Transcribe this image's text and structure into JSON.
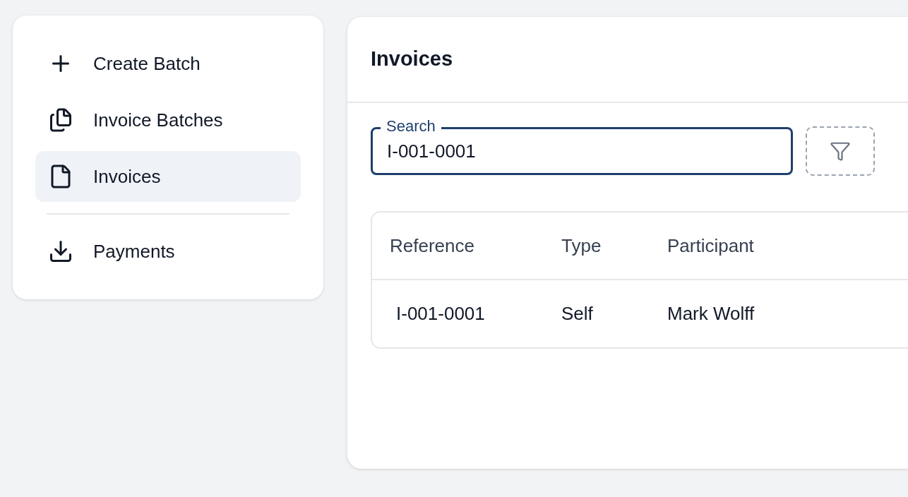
{
  "sidebar": {
    "items": [
      {
        "label": "Create Batch",
        "kind": "create",
        "selected": false
      },
      {
        "label": "Invoice Batches",
        "kind": "batches",
        "selected": false
      },
      {
        "label": "Invoices",
        "kind": "document",
        "selected": true
      },
      {
        "label": "Payments",
        "kind": "payments",
        "selected": false
      }
    ]
  },
  "panel": {
    "title": "Invoices",
    "search": {
      "label": "Search",
      "value": "I-001-0001"
    },
    "table": {
      "columns": [
        "Reference",
        "Type",
        "Participant"
      ],
      "rows": [
        [
          "I-001-0001",
          "Self",
          "Mark Wolff"
        ]
      ]
    }
  }
}
